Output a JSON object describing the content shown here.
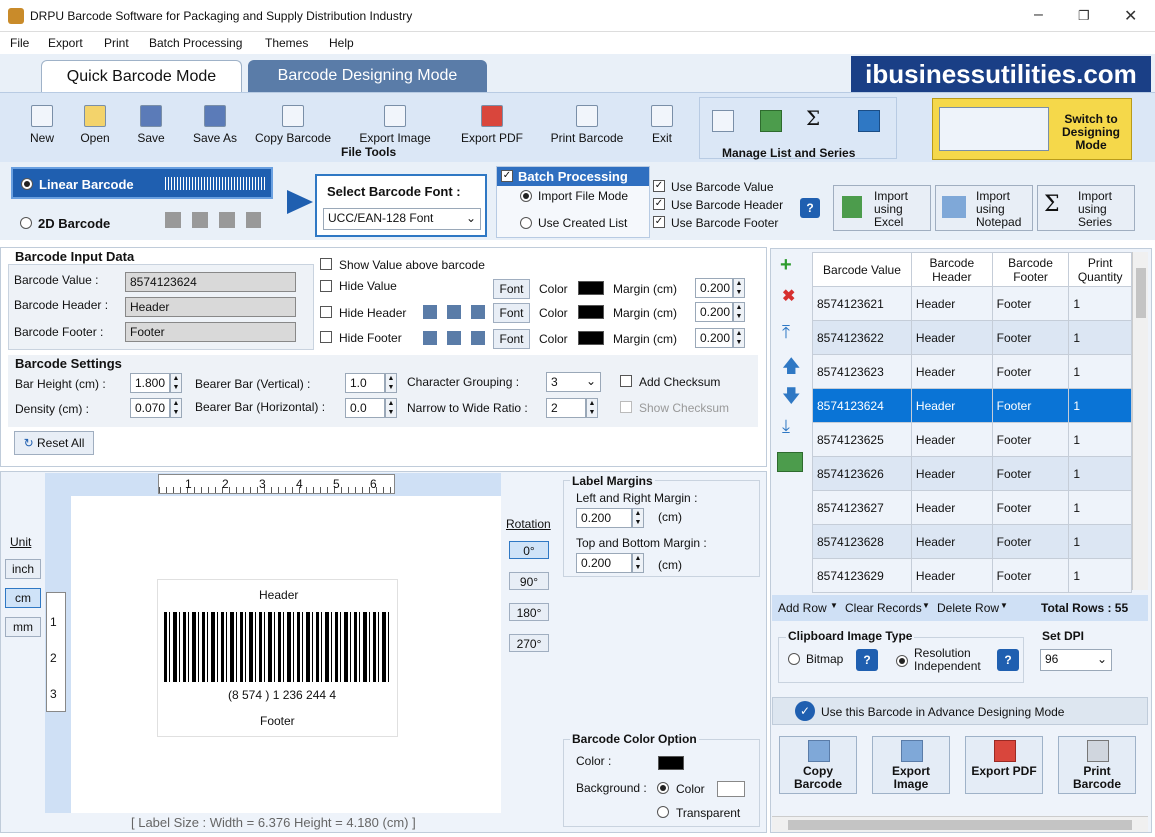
{
  "window": {
    "title": "DRPU Barcode Software for Packaging and Supply Distribution Industry"
  },
  "menu": [
    "File",
    "Export",
    "Print",
    "Batch Processing",
    "Themes",
    "Help"
  ],
  "tabs": {
    "quick": "Quick Barcode Mode",
    "designing": "Barcode Designing Mode"
  },
  "brand": "ibusinessutilities.com",
  "toolbar": {
    "items": [
      "New",
      "Open",
      "Save",
      "Save As",
      "Copy Barcode",
      "Export Image",
      "Export PDF",
      "Print Barcode",
      "Exit"
    ],
    "group_label": "File Tools",
    "manage_label": "Manage List and Series",
    "switch_label": "Switch to Designing Mode"
  },
  "mode": {
    "linear": "Linear Barcode",
    "twod": "2D Barcode",
    "font_label": "Select Barcode Font :",
    "font_value": "UCC/EAN-128 Font"
  },
  "batch": {
    "title": "Batch Processing",
    "import_file": "Import File Mode",
    "use_created": "Use Created List",
    "use_value": "Use Barcode Value",
    "use_header": "Use Barcode Header",
    "use_footer": "Use Barcode Footer",
    "import_excel": "Import using Excel",
    "import_notepad": "Import using Notepad",
    "import_series": "Import using Series"
  },
  "input": {
    "title": "Barcode Input Data",
    "value_label": "Barcode Value :",
    "value": "8574123624",
    "header_label": "Barcode Header :",
    "header": "Header",
    "footer_label": "Barcode Footer :",
    "footer": "Footer",
    "show_above": "Show Value above barcode",
    "hide_value": "Hide Value",
    "hide_header": "Hide Header",
    "hide_footer": "Hide Footer",
    "font": "Font",
    "color": "Color",
    "margin": "Margin (cm)",
    "margin_value": "0.200"
  },
  "settings": {
    "title": "Barcode Settings",
    "bar_height_label": "Bar Height (cm) :",
    "bar_height": "1.800",
    "density_label": "Density (cm) :",
    "density": "0.070",
    "bearer_v_label": "Bearer Bar (Vertical) :",
    "bearer_v": "1.0",
    "bearer_h_label": "Bearer Bar (Horizontal) :",
    "bearer_h": "0.0",
    "char_group_label": "Character Grouping :",
    "char_group": "3",
    "narrow_label": "Narrow to Wide Ratio :",
    "narrow": "2",
    "add_checksum": "Add Checksum",
    "show_checksum": "Show Checksum",
    "reset": "Reset All"
  },
  "preview": {
    "unit": "Unit",
    "units": [
      "inch",
      "cm",
      "mm"
    ],
    "rotation": "Rotation",
    "rotations": [
      "0°",
      "90°",
      "180°",
      "270°"
    ],
    "ruler_h": [
      "1",
      "2",
      "3",
      "4",
      "5",
      "6"
    ],
    "ruler_v": [
      "1",
      "2",
      "3"
    ],
    "header": "Header",
    "human": "(8 574 ) 1 236 244 4",
    "footer": "Footer",
    "label_size": "[ Label Size : Width = 6.376  Height = 4.180 (cm) ]"
  },
  "margins": {
    "title": "Label Margins",
    "lr_label": "Left and Right Margin :",
    "lr": "0.200",
    "tb_label": "Top and Bottom Margin :",
    "tb": "0.200",
    "unit": "(cm)"
  },
  "colors": {
    "title": "Barcode Color Option",
    "color_label": "Color :",
    "bg_label": "Background :",
    "color_opt": "Color",
    "transparent": "Transparent"
  },
  "table": {
    "headers": [
      "Barcode Value",
      "Barcode Header",
      "Barcode Footer",
      "Print Quantity"
    ],
    "rows": [
      [
        "8574123621",
        "Header",
        "Footer",
        "1"
      ],
      [
        "8574123622",
        "Header",
        "Footer",
        "1"
      ],
      [
        "8574123623",
        "Header",
        "Footer",
        "1"
      ],
      [
        "8574123624",
        "Header",
        "Footer",
        "1"
      ],
      [
        "8574123625",
        "Header",
        "Footer",
        "1"
      ],
      [
        "8574123626",
        "Header",
        "Footer",
        "1"
      ],
      [
        "8574123627",
        "Header",
        "Footer",
        "1"
      ],
      [
        "8574123628",
        "Header",
        "Footer",
        "1"
      ],
      [
        "8574123629",
        "Header",
        "Footer",
        "1"
      ]
    ],
    "add_row": "Add Row",
    "clear": "Clear Records",
    "delete": "Delete Row",
    "total": "Total Rows : 55"
  },
  "clipboard": {
    "title": "Clipboard Image Type",
    "bitmap": "Bitmap",
    "resolution": "Resolution Independent",
    "dpi_label": "Set DPI",
    "dpi": "96"
  },
  "advance": "Use this Barcode in Advance Designing Mode",
  "actions": [
    "Copy Barcode",
    "Export Image",
    "Export PDF",
    "Print Barcode"
  ],
  "accent": "#1f5fb0"
}
